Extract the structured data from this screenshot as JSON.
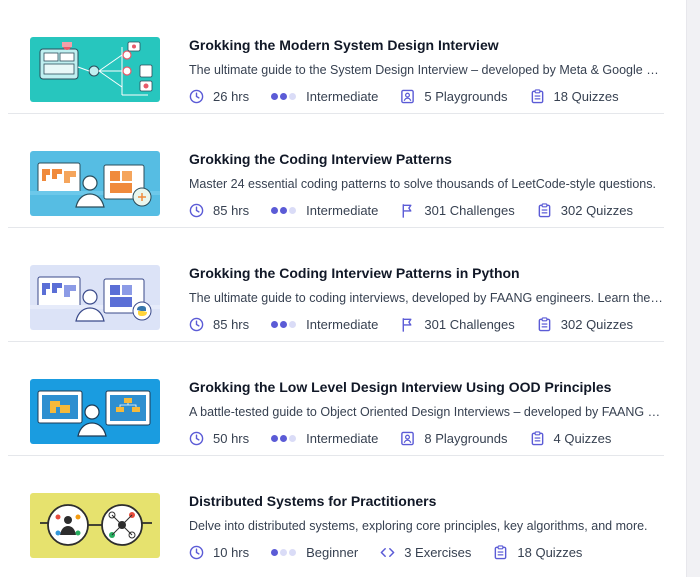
{
  "courses": [
    {
      "title": "Grokking the Modern System Design Interview",
      "description": "The ultimate guide to the System Design Interview – developed by Meta & Google engineers.",
      "hours": "26 hrs",
      "level": "Intermediate",
      "level_value": 2,
      "stat1": {
        "icon": "playground-icon",
        "text": "5 Playgrounds"
      },
      "stat2": {
        "icon": "quiz-icon",
        "text": "18 Quizzes"
      },
      "thumb_color": "#27c6be"
    },
    {
      "title": "Grokking the Coding Interview Patterns",
      "description": "Master 24 essential coding patterns to solve thousands of LeetCode-style questions.",
      "hours": "85 hrs",
      "level": "Intermediate",
      "level_value": 2,
      "stat1": {
        "icon": "flag-icon",
        "text": "301 Challenges"
      },
      "stat2": {
        "icon": "quiz-icon",
        "text": "302 Quizzes"
      },
      "thumb_color": "#56bde3"
    },
    {
      "title": "Grokking the Coding Interview Patterns in Python",
      "description": "The ultimate guide to coding interviews, developed by FAANG engineers. Learn the patterns.",
      "hours": "85 hrs",
      "level": "Intermediate",
      "level_value": 2,
      "stat1": {
        "icon": "flag-icon",
        "text": "301 Challenges"
      },
      "stat2": {
        "icon": "quiz-icon",
        "text": "302 Quizzes"
      },
      "thumb_color": "#dce3f7"
    },
    {
      "title": "Grokking the Low Level Design Interview Using OOD Principles",
      "description": "A battle-tested guide to Object Oriented Design Interviews – developed by FAANG engineers.",
      "hours": "50 hrs",
      "level": "Intermediate",
      "level_value": 2,
      "stat1": {
        "icon": "playground-icon",
        "text": "8 Playgrounds"
      },
      "stat2": {
        "icon": "quiz-icon",
        "text": "4 Quizzes"
      },
      "thumb_color": "#1a9ce0"
    },
    {
      "title": "Distributed Systems for Practitioners",
      "description": "Delve into distributed systems, exploring core principles, key algorithms, and more.",
      "hours": "10 hrs",
      "level": "Beginner",
      "level_value": 1,
      "stat1": {
        "icon": "code-icon",
        "text": "3 Exercises"
      },
      "stat2": {
        "icon": "quiz-icon",
        "text": "18 Quizzes"
      },
      "thumb_color": "#e6e26e"
    }
  ]
}
